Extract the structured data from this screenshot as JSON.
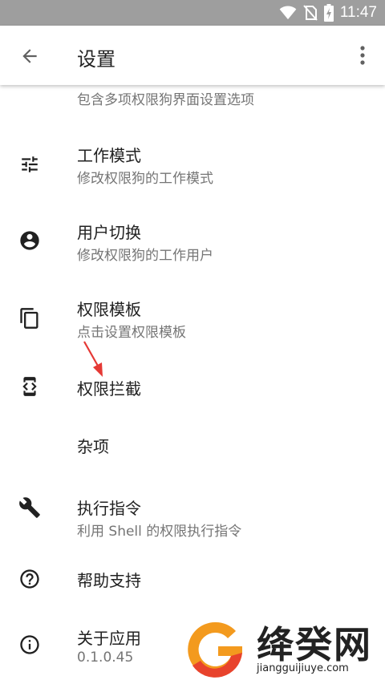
{
  "status_bar": {
    "time": "11:47",
    "icons": [
      "wifi-icon",
      "no-sim-icon",
      "battery-charging-icon"
    ]
  },
  "app_bar": {
    "title": "设置",
    "back_icon": "arrow-back-icon",
    "menu_icon": "more-vert-icon"
  },
  "settings": {
    "items": [
      {
        "title": "",
        "summary": "包含多项权限狗界面设置选项",
        "icon": "gear-icon"
      },
      {
        "title": "工作模式",
        "summary": "修改权限狗的工作模式",
        "icon": "tune-icon"
      },
      {
        "title": "用户切换",
        "summary": "修改权限狗的工作用户",
        "icon": "account-circle-icon"
      },
      {
        "title": "权限模板",
        "summary": "点击设置权限模板",
        "icon": "copy-icon"
      },
      {
        "title": "权限拦截",
        "summary": "",
        "icon": "developer-mode-icon"
      },
      {
        "title": "杂项",
        "summary": "",
        "icon": ""
      },
      {
        "title": "执行指令",
        "summary": "利用 Shell 的权限执行指令",
        "icon": "wrench-icon"
      },
      {
        "title": "帮助支持",
        "summary": "",
        "icon": "help-circle-icon"
      },
      {
        "title": "关于应用",
        "summary": "0.1.0.45",
        "icon": "info-icon"
      }
    ]
  },
  "watermark": {
    "text": "绛癸网",
    "url": "jiangguijiuye.com",
    "colors": {
      "orange": "#f39a1e",
      "red": "#e8432c"
    }
  },
  "colors": {
    "status_bar": "#9e9e9e",
    "annotation_arrow": "#e53935",
    "summary_text": "#757575"
  }
}
